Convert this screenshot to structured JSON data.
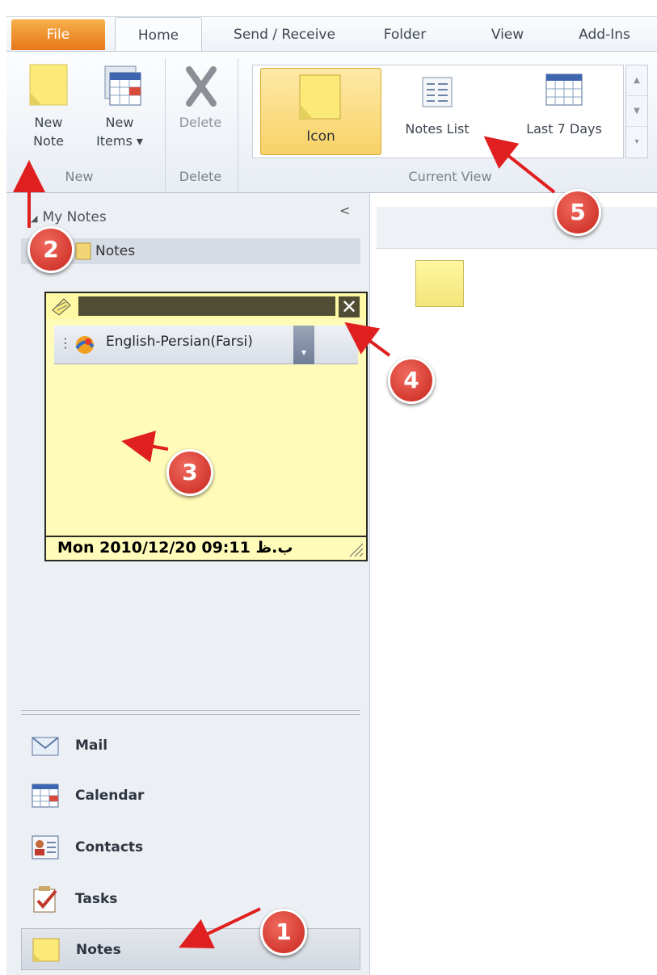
{
  "tabs": {
    "file": "File",
    "home": "Home",
    "send_receive": "Send / Receive",
    "folder": "Folder",
    "view": "View",
    "add_ins": "Add-Ins"
  },
  "ribbon": {
    "new_note": [
      "New",
      "Note"
    ],
    "new_items": [
      "New",
      "Items ▾"
    ],
    "delete": "Delete",
    "group_new": "New",
    "group_delete": "Delete",
    "view_icon": "Icon",
    "view_notes_list": "Notes List",
    "view_last7": "Last 7 Days",
    "group_current_view": "Current View"
  },
  "nav": {
    "header": "My Notes",
    "folder": "Notes",
    "collapse": "<",
    "buttons": [
      "Mail",
      "Calendar",
      "Contacts",
      "Tasks",
      "Notes"
    ]
  },
  "note": {
    "language": "English-Persian(Farsi)",
    "timestamp": "Mon 2010/12/20 09:11 ب.ظ"
  },
  "annotations": [
    "1",
    "2",
    "3",
    "4",
    "5"
  ],
  "colors": {
    "accent_file_tab": "#e7761a",
    "selected_view": "#f8d266",
    "note_yellow": "#fffbb8",
    "badge_red": "#c8251c"
  }
}
